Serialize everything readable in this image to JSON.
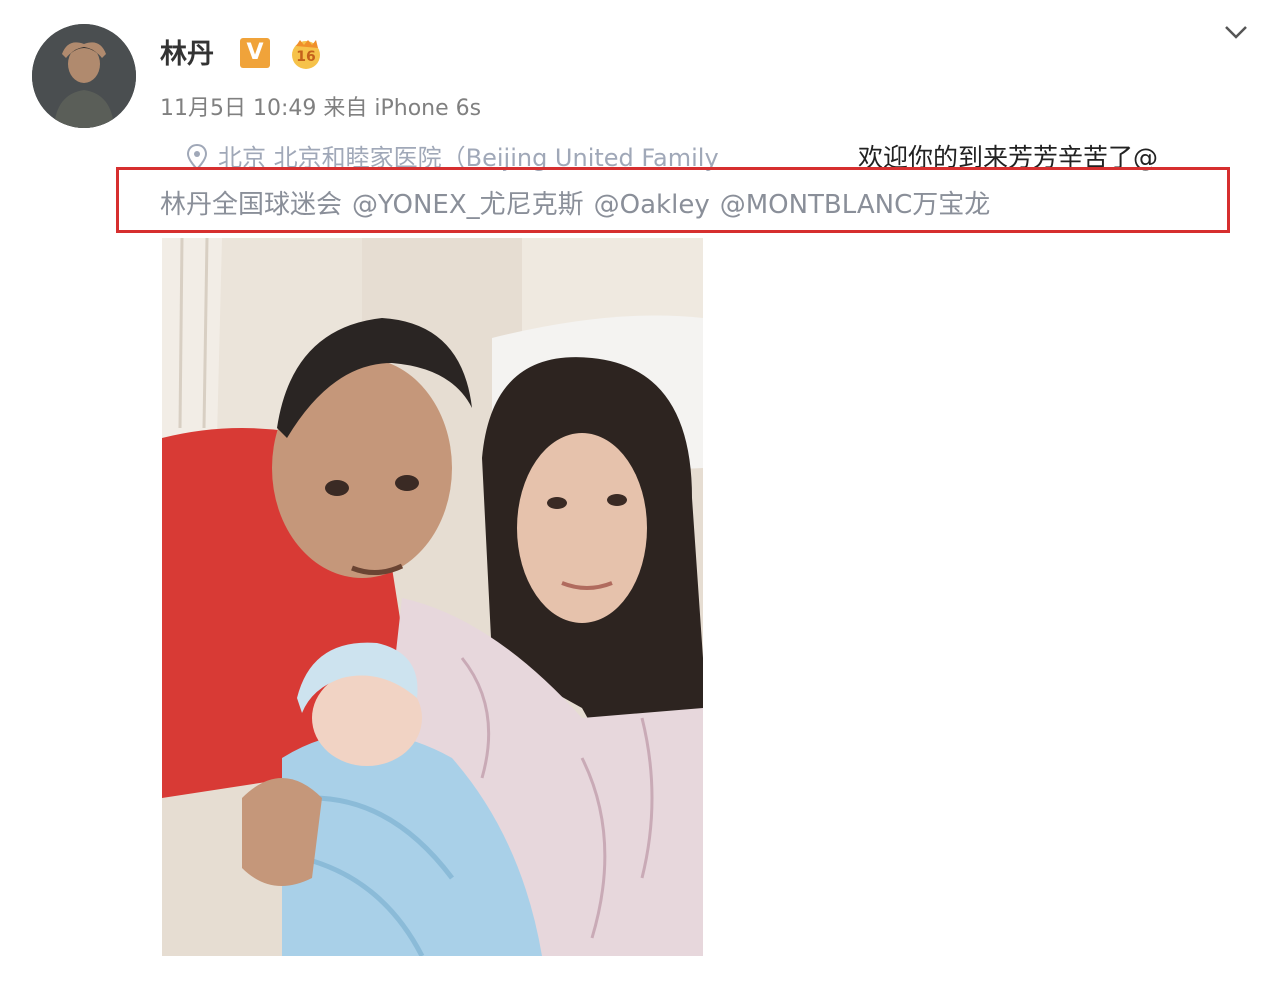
{
  "post": {
    "author": "林丹",
    "verified_mark": "V",
    "member_badge": "16",
    "timestamp": "11月5日 10:49",
    "source": "来自 iPhone 6s",
    "location": "北京 北京和睦家医院（Beijing United Family",
    "text_line1": "欢迎你的到来芳芳辛苦了@",
    "mentions": [
      "林丹全国球迷会",
      "@YONEX_尤尼克斯",
      "@Oakley",
      "@MONTBLANC万宝龙"
    ]
  },
  "icons": {
    "avatar": "avatar",
    "verified": "verified-v-icon",
    "member": "member-badge-icon",
    "menu": "chevron-down-icon",
    "location": "location-pin-icon"
  },
  "colors": {
    "highlight_border": "#d62f2f",
    "verified_badge": "#f0a33a",
    "meta_text": "#808080",
    "mention_text": "#8a8f99"
  }
}
